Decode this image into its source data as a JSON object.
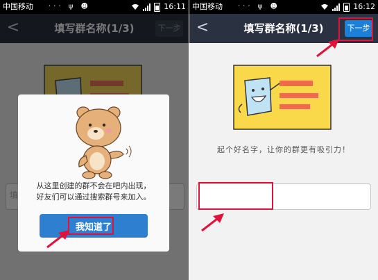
{
  "status_left": {
    "carrier": "中国移动",
    "icons": "··· ψ ☻",
    "time": "16:11"
  },
  "status_right": {
    "carrier": "中国移动",
    "icons": "··· ψ ☻",
    "time": "16:12"
  },
  "header": {
    "back_label": "<",
    "title": "填写群名称(1/3)",
    "next_label": "下一步"
  },
  "dialog": {
    "line1": "从这里创建的群不会在吧内出现，",
    "line2": "好友们可以通过搜索群号来加入。",
    "confirm_label": "我知道了"
  },
  "form": {
    "slogan": "起个好名字，让你的群更有吸引力！",
    "name_value": "",
    "placeholder": "",
    "peek_char": "填"
  },
  "colors": {
    "titlebar": "#2a3140",
    "accent": "#1a80d8",
    "highlight": "#e0123c",
    "card": "#f9d84a"
  },
  "icons": [
    "back-arrow-icon",
    "wifi-icon",
    "signal-icon",
    "battery-icon",
    "usb-icon",
    "notification-icon",
    "pointer-arrow-icon"
  ]
}
